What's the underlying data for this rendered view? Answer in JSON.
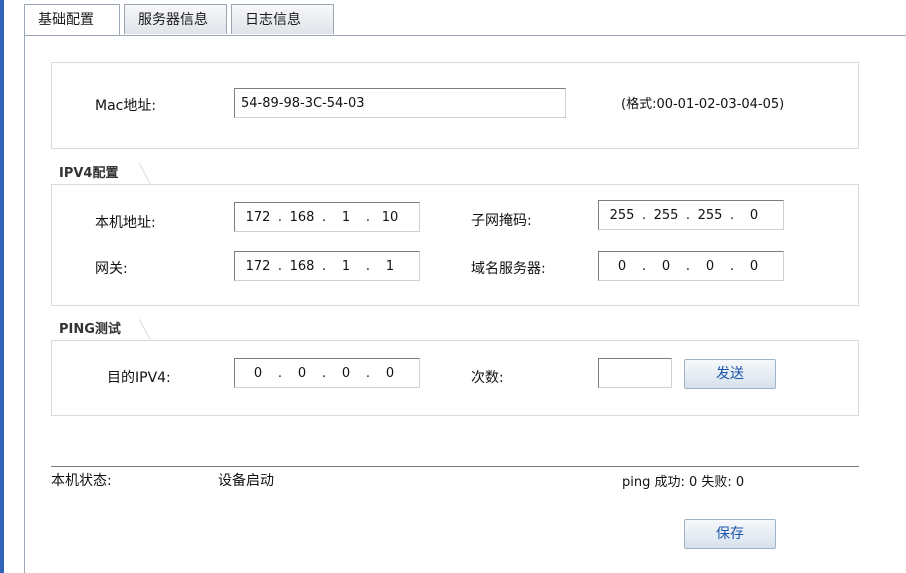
{
  "tabs": [
    {
      "label": "基础配置"
    },
    {
      "label": "服务器信息"
    },
    {
      "label": "日志信息"
    }
  ],
  "mac": {
    "label": "Mac地址:",
    "value": "54-89-98-3C-54-03",
    "hint": "(格式:00-01-02-03-04-05)"
  },
  "ipv4": {
    "legend": "IPV4配置",
    "local_label": "本机地址:",
    "local": [
      "172",
      "168",
      "1",
      "10"
    ],
    "mask_label": "子网掩码:",
    "mask": [
      "255",
      "255",
      "255",
      "0"
    ],
    "gateway_label": "网关:",
    "gateway": [
      "172",
      "168",
      "1",
      "1"
    ],
    "dns_label": "域名服务器:",
    "dns": [
      "0",
      "0",
      "0",
      "0"
    ]
  },
  "ping": {
    "legend": "PING测试",
    "target_label": "目的IPV4:",
    "target": [
      "0",
      "0",
      "0",
      "0"
    ],
    "count_label": "次数:",
    "count_value": "",
    "send_label": "发送"
  },
  "status": {
    "label": "本机状态:",
    "value": "设备启动",
    "result": "ping 成功: 0 失败: 0"
  },
  "save_label": "保存"
}
